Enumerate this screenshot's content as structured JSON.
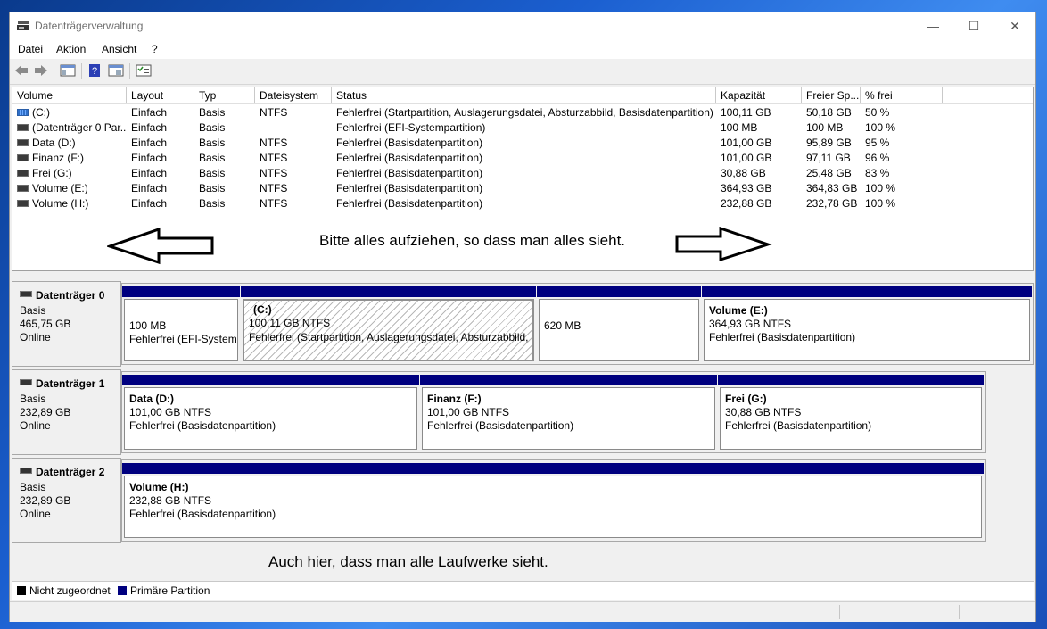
{
  "window": {
    "title": "Datenträgerverwaltung",
    "controls": {
      "minimize": "—",
      "maximize": "☐",
      "close": "✕"
    }
  },
  "menu": [
    "Datei",
    "Aktion",
    "Ansicht",
    "?"
  ],
  "toolbar": [
    "back-icon",
    "forward-icon",
    "console-tree-icon",
    "help-icon",
    "properties-icon",
    "settings-icon"
  ],
  "volume_list": {
    "columns": [
      "Volume",
      "Layout",
      "Typ",
      "Dateisystem",
      "Status",
      "Kapazität",
      "Freier Sp...",
      "% frei"
    ],
    "rows": [
      {
        "volume": "(C:)",
        "layout": "Einfach",
        "typ": "Basis",
        "fs": "NTFS",
        "status": "Fehlerfrei (Startpartition, Auslagerungsdatei, Absturzabbild, Basisdatenpartition)",
        "kap": "100,11 GB",
        "frei": "50,18 GB",
        "pct": "50 %"
      },
      {
        "volume": "(Datenträger 0 Par...",
        "layout": "Einfach",
        "typ": "Basis",
        "fs": "",
        "status": "Fehlerfrei (EFI-Systempartition)",
        "kap": "100 MB",
        "frei": "100 MB",
        "pct": "100 %"
      },
      {
        "volume": "Data (D:)",
        "layout": "Einfach",
        "typ": "Basis",
        "fs": "NTFS",
        "status": "Fehlerfrei (Basisdatenpartition)",
        "kap": "101,00 GB",
        "frei": "95,89 GB",
        "pct": "95 %"
      },
      {
        "volume": "Finanz (F:)",
        "layout": "Einfach",
        "typ": "Basis",
        "fs": "NTFS",
        "status": "Fehlerfrei (Basisdatenpartition)",
        "kap": "101,00 GB",
        "frei": "97,11 GB",
        "pct": "96 %"
      },
      {
        "volume": "Frei (G:)",
        "layout": "Einfach",
        "typ": "Basis",
        "fs": "NTFS",
        "status": "Fehlerfrei (Basisdatenpartition)",
        "kap": "30,88 GB",
        "frei": "25,48 GB",
        "pct": "83 %"
      },
      {
        "volume": "Volume (E:)",
        "layout": "Einfach",
        "typ": "Basis",
        "fs": "NTFS",
        "status": "Fehlerfrei (Basisdatenpartition)",
        "kap": "364,93 GB",
        "frei": "364,83 GB",
        "pct": "100 %"
      },
      {
        "volume": "Volume (H:)",
        "layout": "Einfach",
        "typ": "Basis",
        "fs": "NTFS",
        "status": "Fehlerfrei (Basisdatenpartition)",
        "kap": "232,88 GB",
        "frei": "232,78 GB",
        "pct": "100 %"
      }
    ]
  },
  "annotations": {
    "top": "Bitte alles aufziehen, so dass man alles sieht.",
    "bottom": "Auch hier, dass man alle Laufwerke sieht."
  },
  "disks": [
    {
      "name": "Datenträger 0",
      "type": "Basis",
      "size": "465,75 GB",
      "state": "Online",
      "partitions": [
        {
          "name": "",
          "line1": "100 MB",
          "line2": "Fehlerfrei (EFI-Systemp"
        },
        {
          "name": "(C:)",
          "line1": "100,11 GB NTFS",
          "line2": "Fehlerfrei (Startpartition, Auslagerungsdatei, Absturzabbild, B"
        },
        {
          "name": "",
          "line1": "620 MB",
          "line2": ""
        },
        {
          "name": "Volume  (E:)",
          "line1": "364,93 GB NTFS",
          "line2": "Fehlerfrei (Basisdatenpartition)"
        }
      ]
    },
    {
      "name": "Datenträger 1",
      "type": "Basis",
      "size": "232,89 GB",
      "state": "Online",
      "partitions": [
        {
          "name": "Data  (D:)",
          "line1": "101,00 GB NTFS",
          "line2": "Fehlerfrei (Basisdatenpartition)"
        },
        {
          "name": "Finanz  (F:)",
          "line1": "101,00 GB NTFS",
          "line2": "Fehlerfrei (Basisdatenpartition)"
        },
        {
          "name": "Frei  (G:)",
          "line1": "30,88 GB NTFS",
          "line2": "Fehlerfrei (Basisdatenpartition)"
        }
      ]
    },
    {
      "name": "Datenträger 2",
      "type": "Basis",
      "size": "232,89 GB",
      "state": "Online",
      "partitions": [
        {
          "name": "Volume  (H:)",
          "line1": "232,88 GB NTFS",
          "line2": "Fehlerfrei (Basisdatenpartition)"
        }
      ]
    }
  ],
  "legend": [
    {
      "label": "Nicht zugeordnet",
      "color": "#000000"
    },
    {
      "label": "Primäre Partition",
      "color": "#00007f"
    }
  ]
}
